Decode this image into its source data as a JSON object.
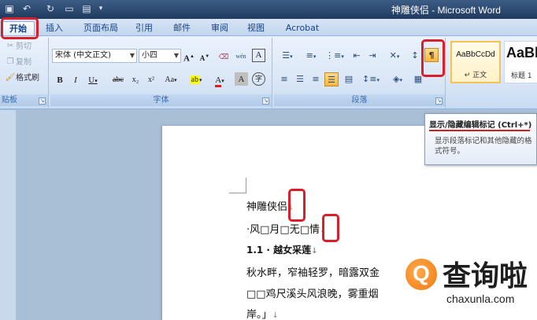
{
  "app": {
    "title": "神雕侠侣 - Microsoft Word"
  },
  "tabs": [
    {
      "label": "开始",
      "active": true
    },
    {
      "label": "插入"
    },
    {
      "label": "页面布局"
    },
    {
      "label": "引用"
    },
    {
      "label": "邮件"
    },
    {
      "label": "审阅"
    },
    {
      "label": "视图"
    },
    {
      "label": "Acrobat"
    }
  ],
  "clipboard": {
    "cut": "剪切",
    "copy": "复制",
    "format_painter": "格式刷",
    "group_label": "贴板"
  },
  "font": {
    "name": "宋体 (中文正文)",
    "size": "小四",
    "grow": "A",
    "shrink": "A",
    "phonetic": "wén",
    "border_char": "A",
    "bold": "B",
    "italic": "I",
    "underline": "U",
    "strike": "abc",
    "subscript": "x₂",
    "superscript": "x²",
    "change_case": "Aa",
    "highlight": "ab",
    "font_color": "A",
    "char_shading": "A",
    "enclose": "字",
    "group_label": "字体"
  },
  "paragraph": {
    "show_marks_glyph": "¶",
    "group_label": "段落"
  },
  "styles": [
    {
      "sample": "AaBbCcDd",
      "name": "正文",
      "selected": true
    },
    {
      "sample": "AaBl",
      "name": "标题 1"
    }
  ],
  "tooltip": {
    "title": "显示/隐藏编辑标记 (Ctrl+*)",
    "body": "显示段落标记和其他隐藏的格式符号。"
  },
  "document": {
    "lines": [
      "神雕侠侣",
      "·风□月□无□情",
      "1.1 · 越女采莲",
      "秋水畔，窄袖轻罗，暗露双金",
      "□□鸡尺溪头风浪晚，雾重烟",
      "岸。」"
    ],
    "para_mark": "↓"
  },
  "watermark": {
    "text": "查询啦",
    "url": "chaxunla.com"
  },
  "colors": {
    "highlight_red": "#d9202a",
    "ribbon_blue": "#15428b",
    "watermark_orange": "#f27a12"
  }
}
